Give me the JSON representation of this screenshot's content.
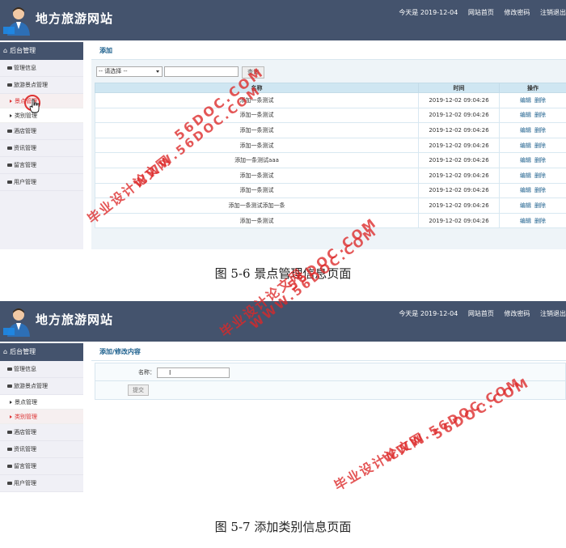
{
  "site": {
    "title": "地方旅游网站",
    "today_label": "今天是 2019-12-04",
    "links": [
      "网站首页",
      "修改密码",
      "注销退出"
    ]
  },
  "screen1": {
    "sidebar": {
      "title": "后台管理",
      "items": [
        {
          "label": "管理信息"
        },
        {
          "label": "旅游景点管理"
        },
        {
          "label": "景点管理",
          "sub": true,
          "active": true
        },
        {
          "label": "类别管理",
          "sub": true
        },
        {
          "label": "酒店管理"
        },
        {
          "label": "资讯管理"
        },
        {
          "label": "留言管理"
        },
        {
          "label": "用户管理"
        }
      ]
    },
    "panel_title": "添加",
    "toolbar": {
      "select_value": "-- 请选择 --",
      "search_button": "查询"
    },
    "table": {
      "headers": [
        "名称",
        "时间",
        "操作"
      ],
      "rows": [
        {
          "name": "添加一条测试",
          "time": "2019-12-02 09:04:26"
        },
        {
          "name": "添加一条测试",
          "time": "2019-12-02 09:04:26"
        },
        {
          "name": "添加一条测试",
          "time": "2019-12-02 09:04:26"
        },
        {
          "name": "添加一条测试",
          "time": "2019-12-02 09:04:26"
        },
        {
          "name": "添加一条测试aaa",
          "time": "2019-12-02 09:04:26"
        },
        {
          "name": "添加一条测试",
          "time": "2019-12-02 09:04:26"
        },
        {
          "name": "添加一条测试",
          "time": "2019-12-02 09:04:26"
        },
        {
          "name": "添加一条测试添加一条",
          "time": "2019-12-02 09:04:26"
        },
        {
          "name": "添加一条测试",
          "time": "2019-12-02 09:04:26"
        }
      ],
      "edit_label": "编辑",
      "delete_label": "删除"
    },
    "caption": "图 5-6 景点管理信息页面"
  },
  "screen2": {
    "sidebar": {
      "title": "后台管理",
      "items": [
        {
          "label": "管理信息"
        },
        {
          "label": "旅游景点管理"
        },
        {
          "label": "景点管理",
          "sub": true
        },
        {
          "label": "类别管理",
          "sub": true,
          "active": true
        },
        {
          "label": "酒店管理"
        },
        {
          "label": "资讯管理"
        },
        {
          "label": "留言管理"
        },
        {
          "label": "用户管理"
        }
      ]
    },
    "panel_title": "添加/修改内容",
    "form": {
      "name_label": "名称：",
      "submit_label": "提交"
    },
    "caption": "图 5-7 添加类别信息页面"
  },
  "watermark": {
    "url": "56DOC.COM",
    "cn": "毕业设计论文网",
    "www": "WWW.56DOC.COM"
  },
  "colors": {
    "header_bg": "#44536d",
    "accent": "#1a5e8c",
    "table_header_bg": "#cfe6f2",
    "watermark": "#dc2828",
    "active_menu": "#d33333"
  }
}
